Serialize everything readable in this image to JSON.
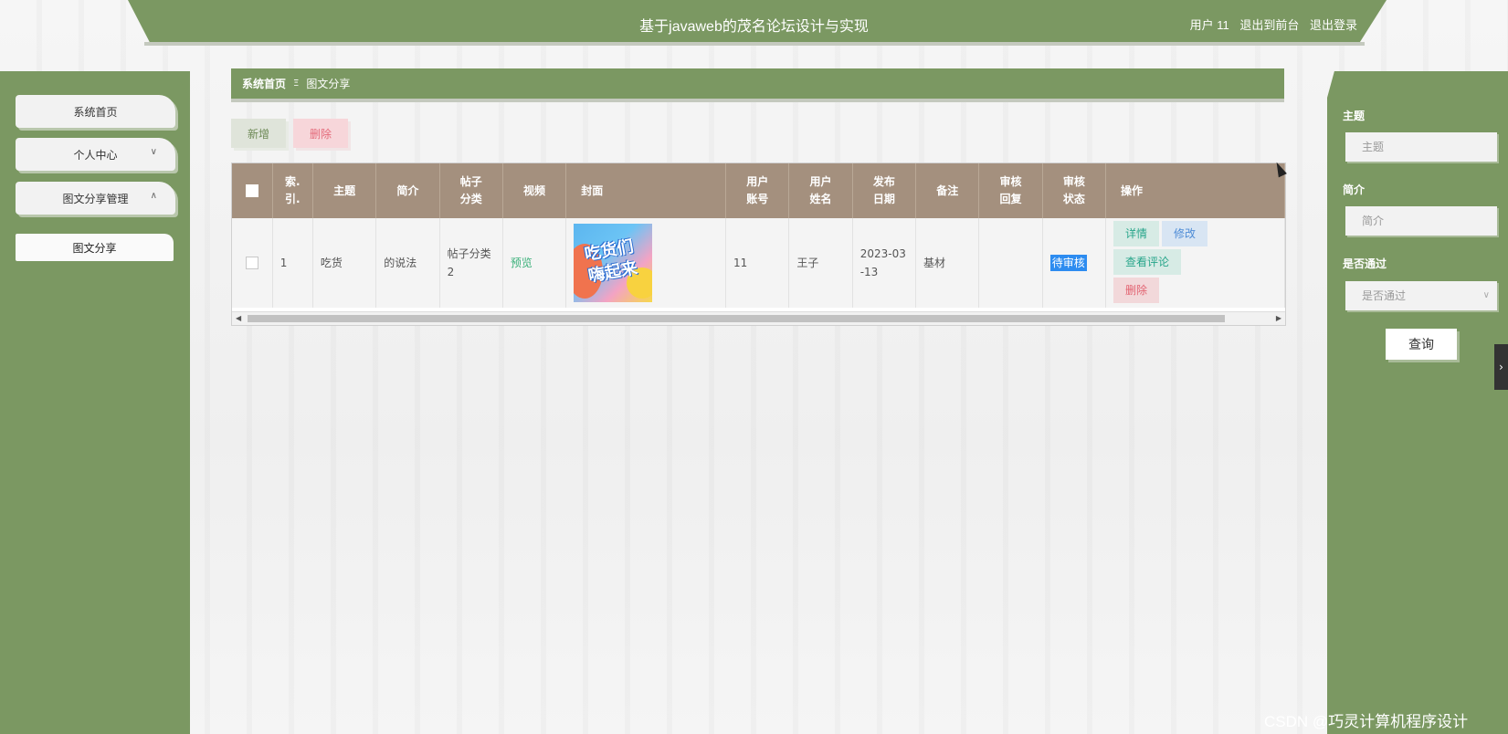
{
  "header": {
    "title": "基于javaweb的茂名论坛设计与实现",
    "user_label": "用户 11",
    "back_to_front": "退出到前台",
    "logout": "退出登录"
  },
  "sidebar": {
    "items": [
      {
        "label": "系统首页"
      },
      {
        "label": "个人中心",
        "chevron": "chevron-down-icon"
      },
      {
        "label": "图文分享管理",
        "chevron": "chevron-up-icon"
      }
    ],
    "subitems": [
      {
        "label": "图文分享"
      }
    ]
  },
  "breadcrumb": {
    "home": "系统首页",
    "separator": "Ξ",
    "current": "图文分享"
  },
  "actions": {
    "add": "新增",
    "delete": "删除"
  },
  "table": {
    "columns": [
      "索.\n引.",
      "主题",
      "简介",
      "帖子\n分类",
      "视频",
      "封面",
      "用户\n账号",
      "用户\n姓名",
      "发布\n日期",
      "备注",
      "审核\n回复",
      "审核\n状态",
      "操作"
    ],
    "rows": [
      {
        "index": "1",
        "theme": "吃货",
        "intro": "的说法",
        "category": "帖子分类2",
        "video": "预览",
        "cover_text": "吃货们\n嗨起来",
        "account": "11",
        "name": "王子",
        "date": "2023-03-13",
        "remark": "基材",
        "reply": "",
        "status": "待审核",
        "ops": {
          "detail": "详情",
          "edit": "修改",
          "comments": "查看评论",
          "delete": "删除"
        }
      }
    ]
  },
  "search": {
    "theme_label": "主题",
    "theme_placeholder": "主题",
    "intro_label": "简介",
    "intro_placeholder": "简介",
    "pass_label": "是否通过",
    "pass_placeholder": "是否通过",
    "button": "查询"
  },
  "collapse_tab": "›",
  "watermark": "CSDN @巧灵计算机程序设计",
  "colors": {
    "primary": "#7b9862",
    "table_header": "#a4907e",
    "status_badge": "#2d8cf0"
  }
}
